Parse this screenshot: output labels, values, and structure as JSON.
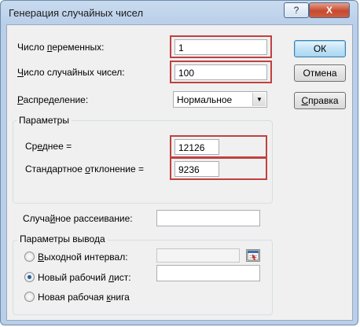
{
  "dialog": {
    "title": "Генерация случайных чисел",
    "help_glyph": "?",
    "close_glyph": "X"
  },
  "fields": {
    "num_variables": {
      "label_pre": "Число ",
      "label_key": "п",
      "label_post": "еременных:",
      "value": "1"
    },
    "num_random": {
      "label_pre": "",
      "label_key": "Ч",
      "label_post": "исло случайных чисел:",
      "value": "100"
    },
    "distribution": {
      "label_pre": "",
      "label_key": "Р",
      "label_post": "аспределение:",
      "value": "Нормальное"
    }
  },
  "buttons": {
    "ok": "ОК",
    "cancel": "Отмена",
    "help_pre": "",
    "help_key": "С",
    "help_post": "правка"
  },
  "parameters": {
    "title": "Параметры",
    "mean": {
      "label_pre": "Ср",
      "label_key": "е",
      "label_post": "днее =",
      "value": "12126"
    },
    "stdev": {
      "label_pre": "Стандартное ",
      "label_key": "о",
      "label_post": "тклонение =",
      "value": "9236"
    }
  },
  "seed": {
    "label_pre": "Случа",
    "label_key": "й",
    "label_post": "ное рассеивание:",
    "value": ""
  },
  "output": {
    "title": "Параметры вывода",
    "options": [
      {
        "label_pre": "",
        "label_key": "В",
        "label_post": "ыходной интервал:",
        "selected": false
      },
      {
        "label_pre": "Новый рабочий ",
        "label_key": "л",
        "label_post": "ист:",
        "selected": true
      },
      {
        "label_pre": "Новая рабочая ",
        "label_key": "к",
        "label_post": "нига",
        "selected": false
      }
    ],
    "output_range_value": "",
    "new_sheet_value": ""
  },
  "colors": {
    "highlight": "#c0413f",
    "title_bar": "#c9dbef",
    "close": "#c54a30"
  }
}
